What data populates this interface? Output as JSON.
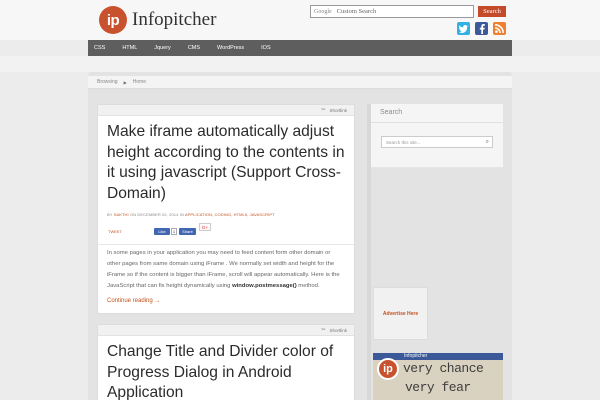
{
  "header": {
    "logo_mark": "ip",
    "site_name": "Infopitcher",
    "search_brand": "Google",
    "search_placeholder": "Custom Search",
    "search_button": "Search"
  },
  "nav": {
    "items": [
      "CSS",
      "HTML",
      "Jquery",
      "CMS",
      "WordPress",
      "IOS"
    ]
  },
  "breadcrumb": {
    "label": "Browsing",
    "current": "Home"
  },
  "posts": [
    {
      "shortlink": "Shortlink",
      "title": "Make iframe automatically adjust height according to the contents in it using javascript (Support Cross-Domain)",
      "meta_prefix": "BY",
      "author": "SAKTHI",
      "date_prefix": "ON",
      "date": "DECEMBER 02, 2014",
      "cat_prefix": "IN",
      "categories": "APPLICATION, CODING, HTML5, JAVASCRIPT",
      "tweet": "TWEET",
      "like": "Like",
      "like_count": "1",
      "share": "Share",
      "gplus": "G+",
      "excerpt_pre": "In some pages in your application you may need to feed content form other domain or other pages from same domain using iFrame . We normally set width and height for the iFrame so if the content is bigger than iFrame, scroll will appear automatically. Here is the JavaScript that can fix height dynamically using ",
      "excerpt_code": "window.postmessage()",
      "excerpt_post": " method.",
      "read_more": "Continue reading →"
    },
    {
      "shortlink": "Shortlink",
      "title": "Change Title and Divider color of Progress Dialog in Android Application"
    }
  ],
  "sidebar": {
    "search_title": "Search",
    "search_placeholder": "Search this site...",
    "advertise": "Advertise Here",
    "fb_name": "Infopitcher",
    "fb_text1": "very chance",
    "fb_text2": "very fear"
  },
  "colors": {
    "accent": "#c2511e",
    "nav": "#5e5e5e",
    "brand": "#c8522e"
  }
}
